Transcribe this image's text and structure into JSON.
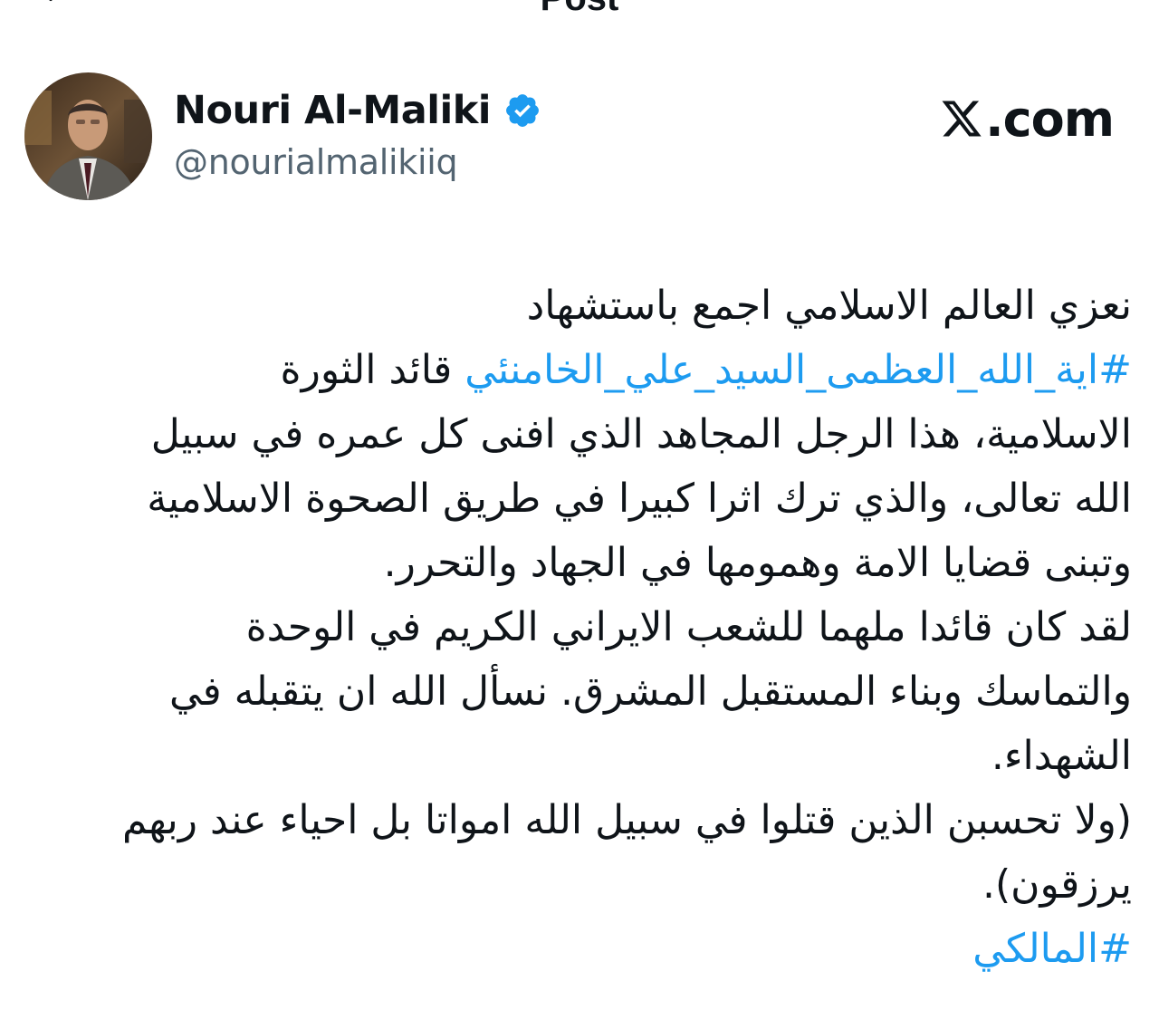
{
  "header": {
    "title": "Post"
  },
  "author": {
    "display_name": "Nouri Al-Maliki",
    "handle": "@nourialmalikiiq",
    "verified": true
  },
  "watermark": {
    "text": ".com",
    "brand": "X"
  },
  "tweet": {
    "lines": [
      {
        "text": "نعزي العالم الاسلامي اجمع باستشهاد"
      },
      {
        "hashtag": "#اية_الله_العظمى_السيد_علي_الخامنئي",
        "text": " قائد الثورة"
      },
      {
        "text": "الاسلامية، هذا الرجل المجاهد الذي افنى كل عمره في سبيل"
      },
      {
        "text": "الله تعالى، والذي ترك اثرا كبيرا في طريق الصحوة الاسلامية"
      },
      {
        "text": "وتبنى قضايا الامة وهمومها في الجهاد والتحرر."
      },
      {
        "text": "لقد كان قائدا ملهما للشعب الايراني الكريم في الوحدة"
      },
      {
        "text": "والتماسك وبناء المستقبل المشرق. نسأل الله ان يتقبله في"
      },
      {
        "text": "الشهداء."
      },
      {
        "text": "(ولا تحسبن الذين قتلوا في سبيل الله امواتا بل احياء عند ربهم"
      },
      {
        "text": "يرزقون)."
      },
      {
        "hashtag": "#المالكي"
      }
    ]
  },
  "colors": {
    "link": "#1d9bf0",
    "verified": "#1d9bf0",
    "text_primary": "#0f1419",
    "text_secondary": "#536471"
  }
}
